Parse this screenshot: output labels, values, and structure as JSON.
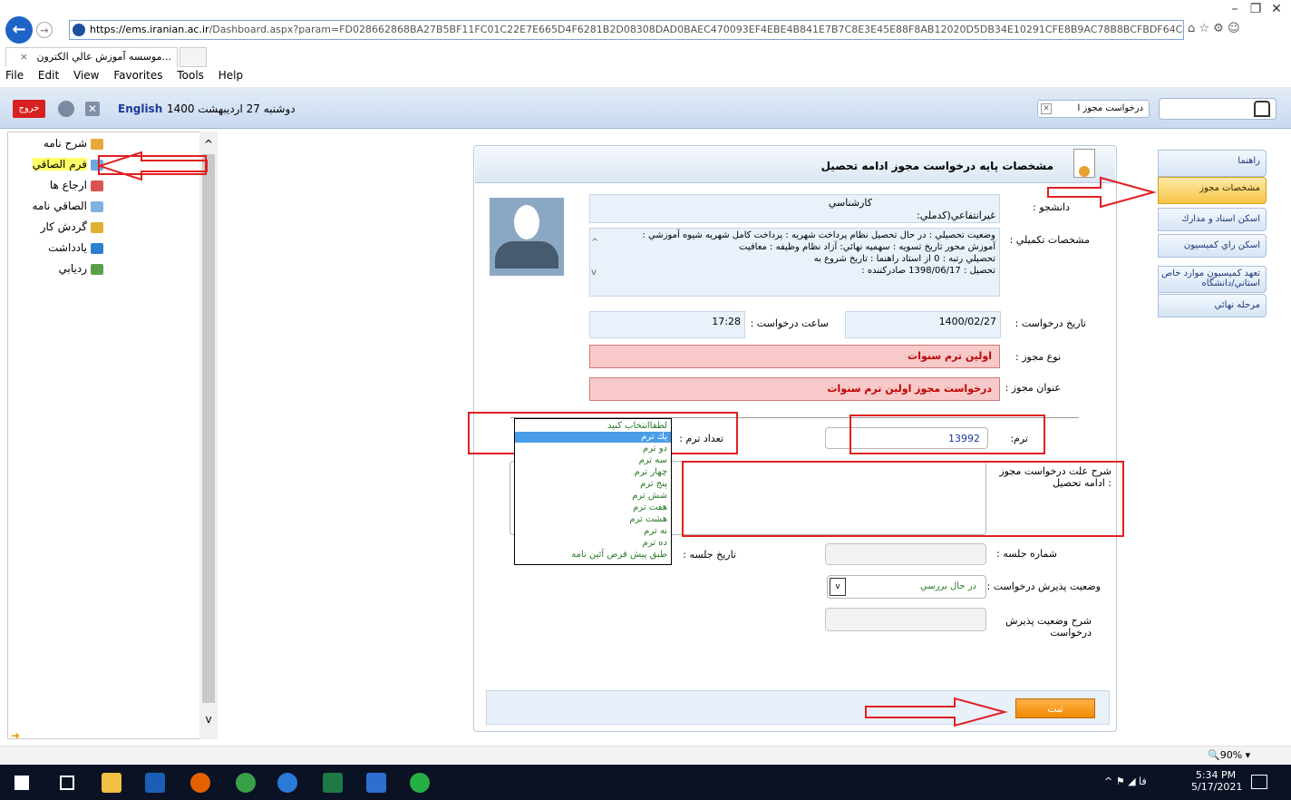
{
  "browser": {
    "url_host": "https://ems.iranian.ac.ir",
    "url_rest": "/Dashboard.aspx?param=FD028662868BA27B5BF11FC01C22E7E665D4F6281B2D08308DAD0BAEC470093EF4EBE4B841E7B7C8E3E45E88F8AB12020D5DB34E10291CFE8B9AC78B8BCFBDF64C4C8888A99",
    "tab_title": "...موسسه آموزش عالي الكترون",
    "tab_close": "×",
    "menu": [
      "File",
      "Edit",
      "View",
      "Favorites",
      "Tools",
      "Help"
    ],
    "window_controls": [
      "–",
      "❐",
      "✕"
    ],
    "zoom": "90%"
  },
  "app_header": {
    "logout": "خروج",
    "english": "English",
    "date": "دوشنبه 27 ارديبهشت 1400",
    "open_tab": "درخواست مجوز ا"
  },
  "sidebar": {
    "items": [
      {
        "label": "شرح نامه",
        "color": "#e7a93a"
      },
      {
        "label": "فرم الصاقي",
        "color": "#6fa8dc",
        "highlight": true
      },
      {
        "label": "ارجاع ها",
        "color": "#d9534f"
      },
      {
        "label": "الصاقي نامه",
        "color": "#7fb0e0"
      },
      {
        "label": "گردش كار",
        "color": "#e0b030"
      },
      {
        "label": "يادداشت",
        "color": "#2d7fd0"
      },
      {
        "label": "رديابي",
        "color": "#5aa04a"
      }
    ]
  },
  "panel": {
    "title": "مشخصات پايه درخواست مجوز ادامه تحصيل",
    "student_label": "دانشجو :",
    "student_line1": "كارشناسي",
    "student_line2": "غيرانتفاعي(كدملي:",
    "details_label": "مشخصات تكميلي :",
    "details_lines": [
      "وضعيت تحصيلي : در حال تحصيل   نظام پرداخت شهريه : پرداخت كامل شهريه   شيوه آموزشي :",
      "آموزش محور   تاريخ تسويه :            سهميه نهائي: آزاد   نظام وظيفه : معافيت",
      "تحصيلي   رتبه : 0 از   استاد راهنما :                  تاريخ شروع به",
      "تحصيل : 1398/06/17   صادركننده :"
    ],
    "request_date_label": "تاريخ درخواست :",
    "request_date": "1400/02/27",
    "request_time_label": "ساعت درخواست :",
    "request_time": "17:28",
    "permit_type_label": "نوع مجوز :",
    "permit_type": "اولين ترم سنوات",
    "permit_title_label": "عنوان مجوز :",
    "permit_title": "درخواست مجوز اولين ترم سنوات",
    "term_label": "ترم:",
    "term_value": "13992",
    "term_count_label": "تعداد ترم :",
    "reason_label": "شرح علت درخواست مجوز : ادامه تحصيل",
    "session_no_label": "شماره جلسه :",
    "session_date_label": "تاريخ جلسه :",
    "accept_status_label": "وضعيت پذيرش درخواست :",
    "accept_status": "در حال بررسي",
    "accept_desc_label": "شرح وضعيت پذيرش درخواست",
    "submit": "ثبت"
  },
  "term_count_options": {
    "options": [
      "لطفاانتخاب كنيد",
      "يك ترم",
      "دو ترم",
      "سه ترم",
      "چهار ترم",
      "پنج ترم",
      "شش ترم",
      "هفت ترم",
      "هشت ترم",
      "نه ترم",
      "ده ترم",
      "طبق پيش فرض آئين نامه"
    ],
    "selected": "يك ترم"
  },
  "right_nav": {
    "items": [
      "راهنما",
      "مشخصات مجوز",
      "اسكن اسناد و مدارك",
      "اسكن راي كميسيون",
      "تعهد كميسيون موارد خاص استاني/دانشگاه",
      "مرحله نهائي"
    ],
    "active": "مشخصات مجوز"
  },
  "taskbar": {
    "time": "5:34 PM",
    "date": "5/17/2021",
    "lang": "فا"
  }
}
